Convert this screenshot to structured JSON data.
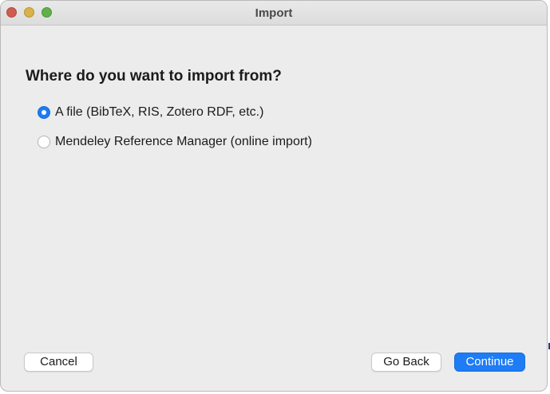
{
  "window": {
    "title": "Import"
  },
  "dialog": {
    "heading": "Where do you want to import from?",
    "options": [
      {
        "label": "A file (BibTeX, RIS, Zotero RDF, etc.)",
        "selected": true
      },
      {
        "label": "Mendeley Reference Manager (online import)",
        "selected": false
      }
    ]
  },
  "buttons": {
    "cancel": "Cancel",
    "back": "Go Back",
    "continue": "Continue"
  },
  "colors": {
    "accent": "#1e7cf5",
    "window_bg": "#ececec"
  }
}
